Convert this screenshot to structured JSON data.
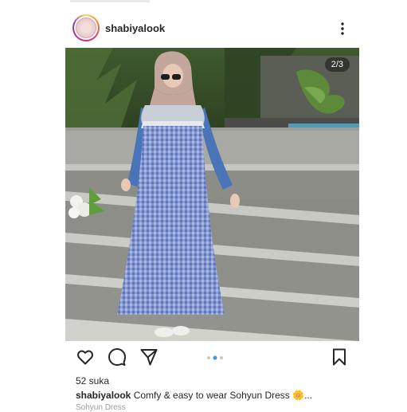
{
  "post": {
    "username": "shabiyalook",
    "image_counter": "2/3",
    "likes": "52 suka",
    "caption_user": "shabiyalook",
    "caption_text": "Comfy & easy to wear Sohyun Dress",
    "caption_emoji": "🌼",
    "caption_more": "...",
    "caption_next_line": "Sohyun Dress"
  },
  "icons": {
    "more": "more-vertical-icon",
    "like": "heart-icon",
    "comment": "comment-icon",
    "share": "send-icon",
    "save": "bookmark-icon"
  },
  "colors": {
    "active_dot": "#3897f0",
    "inactive_dot": "#c7c7c7"
  }
}
